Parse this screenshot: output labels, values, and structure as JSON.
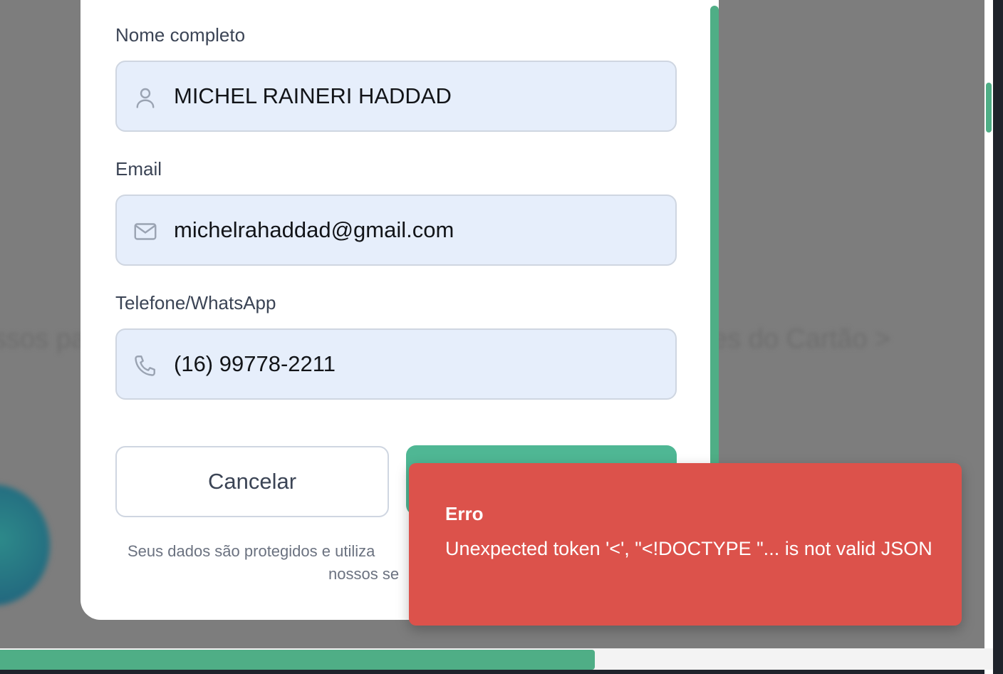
{
  "background": {
    "left_text": "ssos pa",
    "right_text": "es do Cartão >"
  },
  "form": {
    "name": {
      "label": "Nome completo",
      "value": "MICHEL RAINERI HADDAD",
      "icon": "user-icon"
    },
    "email": {
      "label": "Email",
      "value": "michelrahaddad@gmail.com",
      "icon": "mail-icon"
    },
    "phone": {
      "label": "Telefone/WhatsApp",
      "value": "(16) 99778-2211",
      "icon": "phone-icon"
    },
    "cancel_label": "Cancelar",
    "confirm_label": "",
    "footer_line1": "Seus dados são protegidos e utiliza",
    "footer_line2": "nossos se"
  },
  "toast": {
    "title": "Erro",
    "message": "Unexpected token '<', \"<!DOCTYPE \"... is not valid JSON"
  },
  "colors": {
    "accent": "#4fb794",
    "error": "#dc524b",
    "field_bg": "#e6eefb"
  }
}
